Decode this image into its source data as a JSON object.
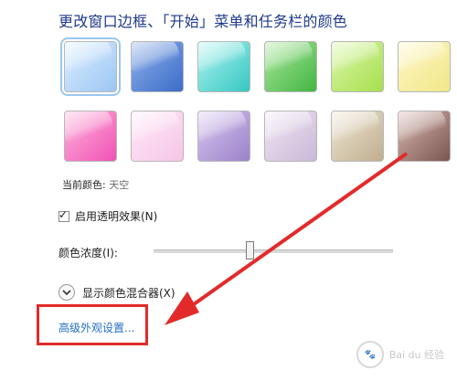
{
  "header": {
    "title": "更改窗口边框、「开始」菜单和任务栏的颜色"
  },
  "swatches": [
    {
      "name": "sky",
      "from": "#dbeeff",
      "to": "#9cc6f3"
    },
    {
      "name": "blue",
      "from": "#8fb0ea",
      "to": "#3a6cc8"
    },
    {
      "name": "teal",
      "from": "#aef3ef",
      "to": "#35c7c1"
    },
    {
      "name": "green",
      "from": "#a9e79a",
      "to": "#43b543"
    },
    {
      "name": "lime",
      "from": "#dbf7a9",
      "to": "#a6df4d"
    },
    {
      "name": "yellow",
      "from": "#fff6c4",
      "to": "#f1e78a"
    },
    {
      "name": "pink",
      "from": "#ffb3dc",
      "to": "#f052b4"
    },
    {
      "name": "light-pink",
      "from": "#ffe8f6",
      "to": "#f6c6e8"
    },
    {
      "name": "purple",
      "from": "#d8c7f0",
      "to": "#9b82c9"
    },
    {
      "name": "lavender",
      "from": "#efe4f2",
      "to": "#cbb9d7"
    },
    {
      "name": "beige",
      "from": "#eee6d4",
      "to": "#bfae8e"
    },
    {
      "name": "brown",
      "from": "#d8b7b0",
      "to": "#7a5650"
    }
  ],
  "current_color": {
    "label": "当前颜色:",
    "value": "天空"
  },
  "transparency": {
    "label": "启用透明效果(N)",
    "checked": true
  },
  "intensity": {
    "label": "颜色浓度(I):",
    "value_fraction": 0.4
  },
  "mixer": {
    "label": "显示颜色混合器(X)"
  },
  "advanced": {
    "label": "高级外观设置..."
  },
  "annotation": {
    "color": "#e32a2a"
  },
  "watermark": {
    "text": "Bai du 经验"
  }
}
